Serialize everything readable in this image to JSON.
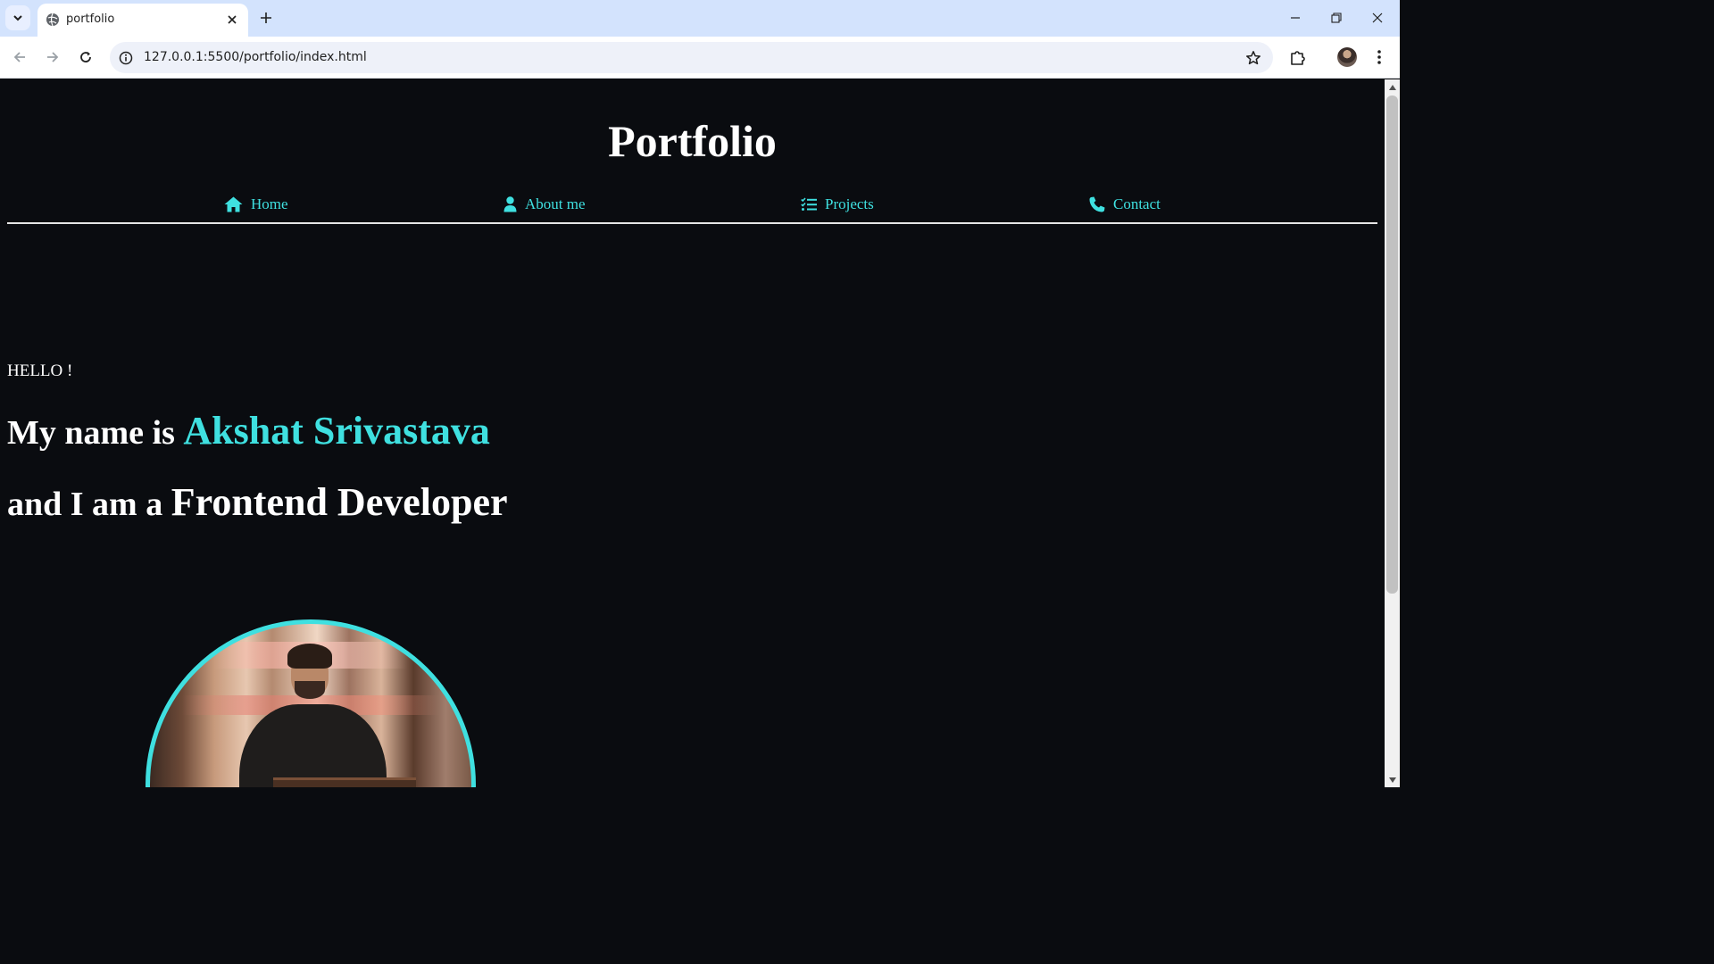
{
  "browser": {
    "tab_title": "portfolio",
    "url": "127.0.0.1:5500/portfolio/index.html"
  },
  "site": {
    "title": "Portfolio",
    "nav": [
      {
        "label": "Home",
        "icon": "home-icon"
      },
      {
        "label": "About me",
        "icon": "user-icon"
      },
      {
        "label": "Projects",
        "icon": "list-check-icon"
      },
      {
        "label": "Contact",
        "icon": "phone-icon"
      }
    ],
    "hero": {
      "greeting": "HELLO !",
      "line1_prefix": "My name is",
      "name": "Akshat Srivastava",
      "line2_prefix": "and I am a",
      "role": "Frontend Developer"
    }
  },
  "colors": {
    "accent": "#3fe0e0",
    "background": "#0a0c10",
    "text": "#ffffff",
    "tabstrip": "#d3e3fd"
  }
}
